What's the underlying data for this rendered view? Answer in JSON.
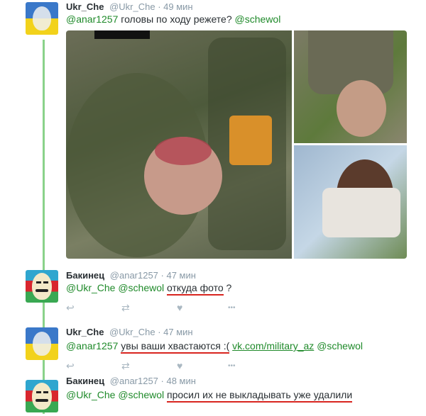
{
  "tweets": [
    {
      "name": "Ukr_Che",
      "meta": "@Ukr_Che · 49 мин",
      "mention1": "@anar1257",
      "text": "головы по ходу режете?",
      "mention2": "@schewol"
    },
    {
      "name": "Бакинец",
      "meta": "@anar1257 · 47 мин",
      "mention1": "@Ukr_Che",
      "mention2": "@schewol",
      "text": "откуда фото",
      "suffix": "?"
    },
    {
      "name": "Ukr_Che",
      "meta": "@Ukr_Che · 47 мин",
      "mention1": "@anar1257",
      "text": "увы ваши хвастаются :(",
      "link": "vk.com/military_az",
      "mention2": "@schewol"
    },
    {
      "name": "Бакинец",
      "meta": "@anar1257 · 48 мин",
      "mention1": "@Ukr_Che",
      "mention2": "@schewol",
      "text": "просил их не выкладывать уже удалили"
    }
  ],
  "icons": {
    "reply": "↩",
    "retweet": "⇄",
    "like": "♥",
    "more": "•••"
  },
  "colors": {
    "thread_line": "#8ad28a",
    "mention": "#1f8a2a",
    "underline": "#d8241f"
  }
}
